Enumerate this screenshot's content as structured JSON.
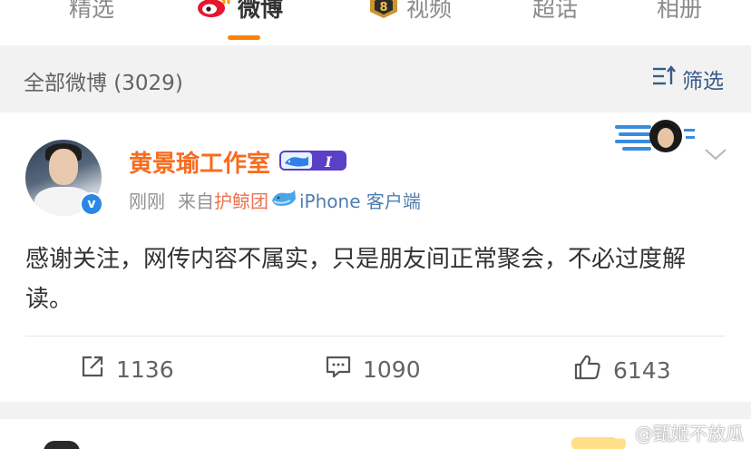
{
  "tabs": [
    {
      "label": "精选",
      "active": false
    },
    {
      "label": "微博",
      "active": true
    },
    {
      "label": "视频",
      "active": false
    },
    {
      "label": "超话",
      "active": false
    },
    {
      "label": "相册",
      "active": false
    }
  ],
  "filter": {
    "title": "全部微博 (3029)",
    "button_label": "筛选"
  },
  "post": {
    "author": "黄景瑜工作室",
    "time": "刚刚",
    "source_prefix": "来自",
    "source_name": "护鲸团",
    "source_client": "iPhone 客户端",
    "text": "感谢关注，网传内容不属实，只是朋友间正常聚会，不必过度解读。",
    "vip_level": "I",
    "reposts": "1136",
    "comments": "1090",
    "likes": "6143"
  },
  "watermark": "@甄姬不放瓜",
  "colors": {
    "accent": "#ff8200",
    "author": "#f86b1d",
    "link": "#507daf",
    "verified": "#2b87e6"
  },
  "icons": [
    "weibo-logo-icon",
    "video-badge-icon",
    "filter-icon",
    "verified-icon",
    "vip-whale-badge-icon",
    "whale-icon",
    "chevron-down-icon",
    "repost-icon",
    "comment-icon",
    "like-icon"
  ]
}
